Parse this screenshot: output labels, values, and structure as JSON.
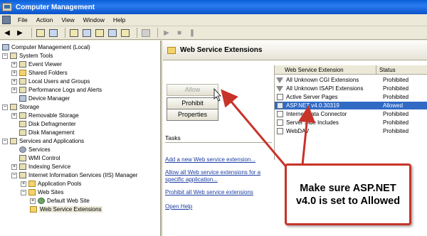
{
  "window": {
    "title": "Computer Management"
  },
  "menu": [
    "File",
    "Action",
    "View",
    "Window",
    "Help"
  ],
  "toolbar_icons": [
    "back-icon",
    "forward-icon",
    "up-folder-icon",
    "show-hide-tree-icon",
    "properties-icon",
    "refresh-icon",
    "export-icon",
    "help-icon",
    "console-icon",
    "play-icon",
    "stop-icon",
    "pause-icon"
  ],
  "tree": [
    {
      "label": "Computer Management (Local)",
      "icon": "computer-icon"
    },
    {
      "label": "System Tools",
      "icon": "tools-icon"
    },
    {
      "label": "Event Viewer",
      "icon": "event-viewer-icon"
    },
    {
      "label": "Shared Folders",
      "icon": "shared-folders-icon"
    },
    {
      "label": "Local Users and Groups",
      "icon": "users-icon"
    },
    {
      "label": "Performance Logs and Alerts",
      "icon": "performance-icon"
    },
    {
      "label": "Device Manager",
      "icon": "device-manager-icon"
    },
    {
      "label": "Storage",
      "icon": "storage-icon"
    },
    {
      "label": "Removable Storage",
      "icon": "removable-storage-icon"
    },
    {
      "label": "Disk Defragmenter",
      "icon": "defrag-icon"
    },
    {
      "label": "Disk Management",
      "icon": "disk-management-icon"
    },
    {
      "label": "Services and Applications",
      "icon": "services-apps-icon"
    },
    {
      "label": "Services",
      "icon": "services-icon"
    },
    {
      "label": "WMI Control",
      "icon": "wmi-icon"
    },
    {
      "label": "Indexing Service",
      "icon": "indexing-icon"
    },
    {
      "label": "Internet Information Services (IIS) Manager",
      "icon": "iis-icon"
    },
    {
      "label": "Application Pools",
      "icon": "folder-icon"
    },
    {
      "label": "Web Sites",
      "icon": "folder-icon"
    },
    {
      "label": "Default Web Site",
      "icon": "globe-icon"
    },
    {
      "label": "Web Service Extensions",
      "icon": "folder-icon"
    }
  ],
  "panel": {
    "title": "Web Service Extensions",
    "buttons": {
      "allow": "Allow",
      "prohibit": "Prohibit",
      "properties": "Properties"
    },
    "tasks_title": "Tasks",
    "links": [
      "Add a new Web service extension...",
      "Allow all Web service extensions for a specific application...",
      "Prohibit all Web service extensions",
      "Open Help"
    ]
  },
  "extensions": {
    "columns": [
      "Web Service Extension",
      "Status"
    ],
    "rows": [
      {
        "name": "All Unknown CGI Extensions",
        "status": "Prohibited",
        "icon": "filter-icon"
      },
      {
        "name": "All Unknown ISAPI Extensions",
        "status": "Prohibited",
        "icon": "filter-icon"
      },
      {
        "name": "Active Server Pages",
        "status": "Prohibited",
        "icon": "extension-icon"
      },
      {
        "name": "ASP.NET v4.0.30319",
        "status": "Allowed",
        "icon": "allowed-extension-icon",
        "selected": true
      },
      {
        "name": "Internet Data Connector",
        "status": "Prohibited",
        "icon": "extension-icon"
      },
      {
        "name": "Server Side Includes",
        "status": "Prohibited",
        "icon": "extension-icon"
      },
      {
        "name": "WebDAV",
        "status": "Prohibited",
        "icon": "extension-icon"
      }
    ]
  },
  "callout": {
    "line1": "Make sure ASP.NET",
    "line2": "v4.0 is set to Allowed",
    "border_color": "#c8332a"
  },
  "colors": {
    "selection": "#316ac5",
    "titlebar": "#0a5fd8",
    "link": "#1c3ea3"
  }
}
